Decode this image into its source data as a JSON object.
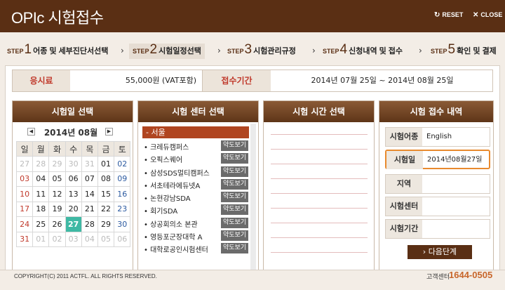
{
  "header": {
    "title": "OPIc 시험접수",
    "reset_label": "RESET",
    "close_label": "CLOSE",
    "reset_icon": "reset-icon",
    "close_icon": "close-icon"
  },
  "steps": [
    {
      "prefix": "STEP",
      "num": "1",
      "label": "어종 및 세부진단서선택"
    },
    {
      "prefix": "STEP",
      "num": "2",
      "label": "시험일정선택"
    },
    {
      "prefix": "STEP",
      "num": "3",
      "label": "시험관리규정"
    },
    {
      "prefix": "STEP",
      "num": "4",
      "label": "신청내역 및 접수"
    },
    {
      "prefix": "STEP",
      "num": "5",
      "label": "확인 및 결제"
    }
  ],
  "info": {
    "fee_label": "응시료",
    "fee_value": "55,000원 (VAT포함)",
    "period_label": "접수기간",
    "period_value": "2014년 07월 25일  ~ 2014년 08월 25일"
  },
  "calendar": {
    "header": "시험일 선택",
    "month_label": "2014년 08월",
    "weekdays": [
      "일",
      "월",
      "화",
      "수",
      "목",
      "금",
      "토"
    ],
    "weeks": [
      [
        "27",
        "28",
        "29",
        "30",
        "31",
        "01",
        "02"
      ],
      [
        "03",
        "04",
        "05",
        "06",
        "07",
        "08",
        "09"
      ],
      [
        "10",
        "11",
        "12",
        "13",
        "14",
        "15",
        "16"
      ],
      [
        "17",
        "18",
        "19",
        "20",
        "21",
        "22",
        "23"
      ],
      [
        "24",
        "25",
        "26",
        "27",
        "28",
        "29",
        "30"
      ],
      [
        "31",
        "01",
        "02",
        "03",
        "04",
        "05",
        "06"
      ]
    ],
    "selected": "27"
  },
  "centers": {
    "header": "시험 센터 선택",
    "region": "- 서울",
    "map_label": "약도보기",
    "items": [
      "크레듀캠퍼스",
      "오픽스퀘어",
      "삼성SDS멀티캠퍼스",
      "서초테라에듀넷A",
      "논현강남SDA",
      "회기SDA",
      "상공회의소 본관",
      "영등포군장대학 A",
      "대학로공인시험센터"
    ]
  },
  "times": {
    "header": "시험 시간 선택"
  },
  "summary": {
    "header": "시험 접수 내역",
    "rows": [
      {
        "key": "시험어종",
        "value": "English"
      },
      {
        "key": "시험일",
        "value": "2014년08월27일"
      },
      {
        "key": "지역",
        "value": ""
      },
      {
        "key": "시험센터",
        "value": ""
      },
      {
        "key": "시험기간",
        "value": ""
      }
    ],
    "next_label": "› 다음단계"
  },
  "footer": {
    "copyright": "COPYRIGHT(C) 2011 ACTFL. ALL RIGHTS RESERVED.",
    "support_label": "고객센터",
    "phone": "1644-0505"
  }
}
